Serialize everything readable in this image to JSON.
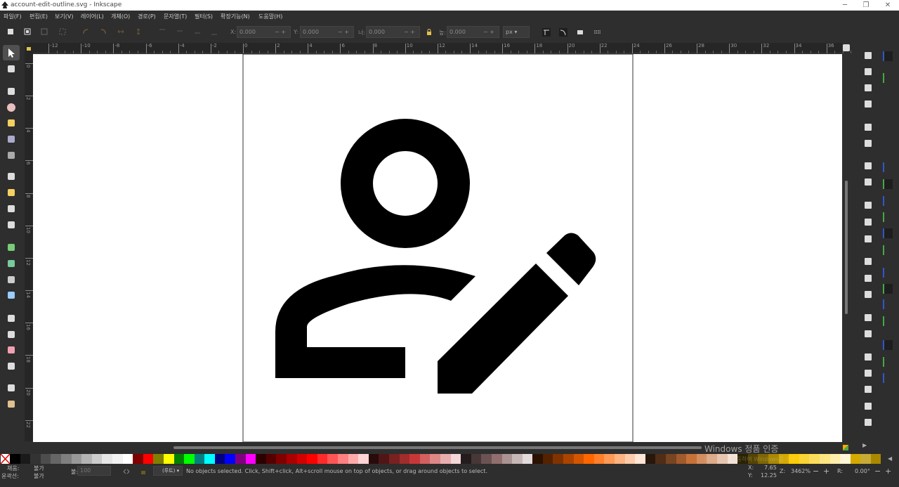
{
  "window": {
    "title": "account-edit-outline.svg - Inkscape",
    "minimize": "─",
    "maximize": "❐",
    "close": "✕"
  },
  "menu": [
    "파일(F)",
    "편집(E)",
    "보기(V)",
    "레이어(L)",
    "개체(O)",
    "경로(P)",
    "문자열(T)",
    "필터(S)",
    "확장기능(N)",
    "도움말(H)"
  ],
  "toolbar": {
    "x_label": "X:",
    "x_value": "0.000",
    "y_label": "Y:",
    "y_value": "0.000",
    "w_label": "너:",
    "w_value": "0.000",
    "h_label": "높:",
    "h_value": "0.000",
    "unit": "px"
  },
  "ruler_top_ticks": [
    "-12",
    "-10",
    "-8",
    "-6",
    "-4",
    "-2",
    "0",
    "2",
    "4",
    "6",
    "8",
    "10",
    "12",
    "14",
    "16",
    "18",
    "20",
    "22",
    "24",
    "26",
    "28",
    "30",
    "32",
    "34",
    "36"
  ],
  "ruler_left_ticks": [
    "0",
    "2",
    "4",
    "6",
    "8",
    "10",
    "12",
    "14",
    "16",
    "18",
    "20",
    "22",
    "24"
  ],
  "tools": [
    "selector-tool-icon",
    "node-tool-icon",
    "rect-tool-icon",
    "ellipse-tool-icon",
    "star-tool-icon",
    "3dbox-tool-icon",
    "spiral-tool-icon",
    "pencil-tool-icon",
    "pen-tool-icon",
    "calligraphy-tool-icon",
    "text-tool-icon",
    "gradient-tool-icon",
    "mesh-tool-icon",
    "dropper-tool-icon",
    "paint-bucket-tool-icon",
    "tweak-tool-icon",
    "spray-tool-icon",
    "eraser-tool-icon",
    "connector-tool-icon",
    "zoom-tool-icon",
    "measure-tool-icon"
  ],
  "palette_colors": [
    "#000000",
    "#1a1a1a",
    "#333333",
    "#4d4d4d",
    "#666666",
    "#808080",
    "#999999",
    "#b3b3b3",
    "#cccccc",
    "#e6e6e6",
    "#f2f2f2",
    "#ffffff",
    "#800000",
    "#ff0000",
    "#808000",
    "#ffff00",
    "#008000",
    "#00ff00",
    "#008080",
    "#00ffff",
    "#000080",
    "#0000ff",
    "#800080",
    "#ff00ff",
    "#2b0000",
    "#550000",
    "#800000",
    "#aa0000",
    "#d40000",
    "#ff0000",
    "#ff2a2a",
    "#ff5555",
    "#ff8080",
    "#ffaaaa",
    "#ffd5d5",
    "#280b0b",
    "#501616",
    "#782121",
    "#a02c2c",
    "#c83737",
    "#d35f5f",
    "#de8787",
    "#e9afaf",
    "#f4d7d7",
    "#241c1c",
    "#483737",
    "#6c5353",
    "#916f6f",
    "#ac9393",
    "#c8b7b7",
    "#e3dbdb",
    "#2b1100",
    "#552200",
    "#803300",
    "#aa4400",
    "#d45500",
    "#ff6600",
    "#ff7f2a",
    "#ff9955",
    "#ffb380",
    "#ffccaa",
    "#ffe6d5",
    "#28170b",
    "#502d16",
    "#784421",
    "#a05a2c",
    "#c87137",
    "#d38d5f",
    "#deaa87",
    "#e9c6af",
    "#f4e3d7",
    "#2b2200",
    "#554400",
    "#806600",
    "#aa8800",
    "#d4aa00",
    "#ffcc00",
    "#ffd42a",
    "#ffdd55",
    "#ffe680",
    "#ffeeaa",
    "#fff6d5",
    "#d4aa00",
    "#c8ab37",
    "#aa8800"
  ],
  "status": {
    "fill_label": "채움:",
    "fill_value": "불가",
    "stroke_label": "윤곽선:",
    "stroke_value": "불가",
    "opacity_label": "불:",
    "opacity_value": "100",
    "layer": "(루트)",
    "message": "No objects selected. Click, Shift+click, Alt+scroll mouse on top of objects, or drag around objects to select.",
    "x_label": "X:",
    "x_value": "7.65",
    "y_label": "Y:",
    "y_value": "12.25",
    "zoom_label": "Z:",
    "zoom_value": "3462%",
    "rotate_label": "R:",
    "rotate_value": "0.00°"
  },
  "watermark": {
    "title": "Windows 정품 인증",
    "subtitle": "[설정]으로 이동하여 Windows를 정품 인증합니다."
  }
}
